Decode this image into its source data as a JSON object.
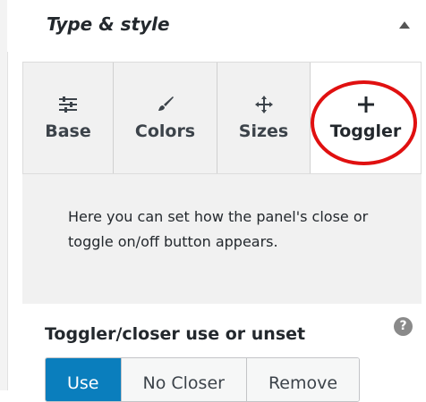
{
  "panel": {
    "title": "Type & style"
  },
  "tabs": [
    {
      "label": "Base",
      "icon": "sliders-icon"
    },
    {
      "label": "Colors",
      "icon": "brush-icon"
    },
    {
      "label": "Sizes",
      "icon": "move-arrows-icon"
    },
    {
      "label": "Toggler",
      "icon": "plus-icon",
      "active": true
    }
  ],
  "description": "Here you can set how the panel's close or toggle on/off button appears.",
  "toggler": {
    "title": "Toggler/closer use or unset",
    "help": "?",
    "options": [
      "Use",
      "No Closer",
      "Remove"
    ],
    "selected": "Use"
  },
  "colors": {
    "accent": "#0a7ebd",
    "highlight_circle": "#e01010"
  }
}
